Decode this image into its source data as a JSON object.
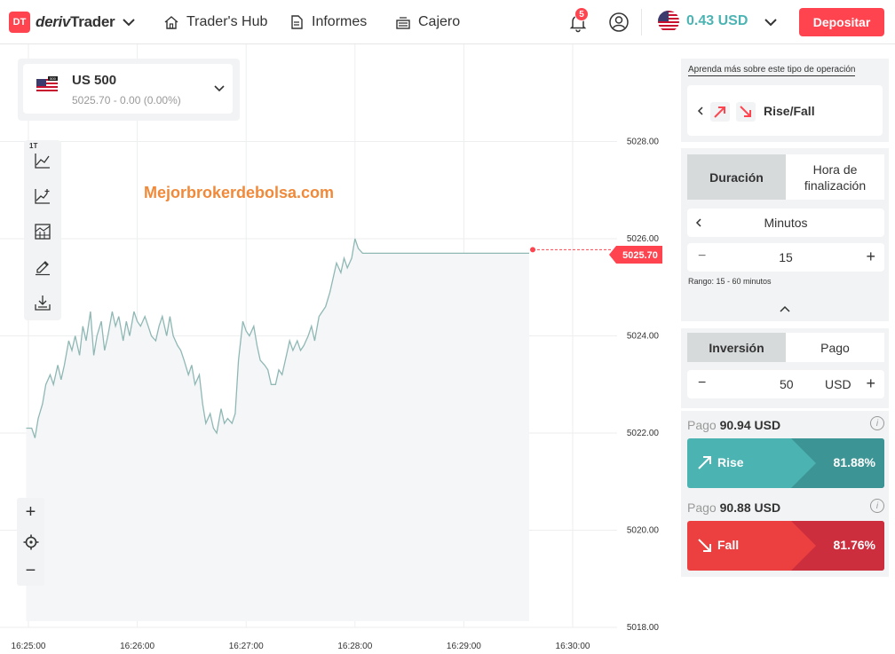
{
  "header": {
    "logo_badge": "DT",
    "logo_brand": "deriv",
    "logo_product": "Trader",
    "nav": [
      {
        "label": "Trader's Hub",
        "icon": "home-icon"
      },
      {
        "label": "Informes",
        "icon": "reports-icon"
      },
      {
        "label": "Cajero",
        "icon": "cashier-icon"
      }
    ],
    "notifications_count": "5",
    "balance": "0.43 USD",
    "deposit_label": "Depositar"
  },
  "chart": {
    "symbol_name": "US 500",
    "symbol_quote": "5025.70 - 0.00 (0.00%)",
    "flag_label": "500",
    "current_price": "5025.70",
    "watermark": "Mejorbrokerdebolsa.com",
    "toolbar_interval": "1T",
    "zoom_in": "+",
    "zoom_out": "−"
  },
  "chart_data": {
    "type": "area",
    "y_ticks": [
      "5018.00",
      "5020.00",
      "5022.00",
      "5024.00",
      "5026.00",
      "5028.00"
    ],
    "x_ticks": [
      "16:25:00",
      "16:26:00",
      "16:27:00",
      "16:28:00",
      "16:29:00",
      "16:30:00"
    ],
    "ylim": [
      5018,
      5030
    ],
    "x": [
      -0.02,
      0.03,
      0.06,
      0.09,
      0.13,
      0.16,
      0.2,
      0.23,
      0.27,
      0.3,
      0.33,
      0.37,
      0.4,
      0.43,
      0.47,
      0.5,
      0.53,
      0.57,
      0.6,
      0.63,
      0.67,
      0.7,
      0.73,
      0.77,
      0.8,
      0.83,
      0.87,
      0.9,
      0.93,
      0.97,
      1.0,
      1.03,
      1.07,
      1.1,
      1.13,
      1.17,
      1.2,
      1.23,
      1.27,
      1.3,
      1.33,
      1.37,
      1.4,
      1.43,
      1.47,
      1.5,
      1.53,
      1.57,
      1.6,
      1.63,
      1.67,
      1.7,
      1.73,
      1.77,
      1.8,
      1.83,
      1.87,
      1.9,
      1.93,
      1.97,
      2.0,
      2.03,
      2.07,
      2.1,
      2.13,
      2.17,
      2.2,
      2.23,
      2.27,
      2.3,
      2.33,
      2.37,
      2.4,
      2.43,
      2.47,
      2.5,
      2.53,
      2.57,
      2.6,
      2.63,
      2.67,
      2.7,
      2.73,
      2.77,
      2.8,
      2.83,
      2.87,
      2.9,
      2.93,
      2.97,
      3.0,
      3.03,
      3.07,
      3.1,
      3.13,
      3.17,
      3.2,
      3.23,
      3.27,
      3.3,
      3.33,
      3.37,
      3.4,
      3.43,
      3.47,
      3.5,
      3.53,
      3.57,
      3.6,
      3.63,
      3.67,
      3.7,
      3.73,
      3.77,
      3.8,
      3.83,
      3.87,
      3.9,
      3.93,
      3.97,
      4.0,
      4.03,
      4.07,
      4.1,
      4.13,
      4.17,
      4.2,
      4.23,
      4.27,
      4.3,
      4.33,
      4.37,
      4.4,
      4.43,
      4.47,
      4.5,
      4.53,
      4.57,
      4.6,
      4.63,
      4.67,
      4.7,
      4.73,
      4.77,
      4.8,
      4.83,
      4.87,
      4.9
    ],
    "y": [
      5022.1,
      5022.1,
      5021.9,
      5022.3,
      5022.6,
      5023.0,
      5023.2,
      5023.0,
      5023.4,
      5023.1,
      5023.4,
      5023.9,
      5023.7,
      5024.0,
      5023.6,
      5024.2,
      5023.9,
      5024.5,
      5023.6,
      5024.0,
      5024.3,
      5023.7,
      5024.0,
      5024.5,
      5024.2,
      5024.4,
      5023.9,
      5024.3,
      5024.0,
      5024.5,
      5024.3,
      5024.2,
      5024.4,
      5024.2,
      5024.0,
      5023.9,
      5024.2,
      5024.4,
      5024.0,
      5024.4,
      5024.0,
      5023.8,
      5023.7,
      5023.5,
      5023.2,
      5023.4,
      5023.0,
      5023.2,
      5022.6,
      5022.2,
      5022.4,
      5022.1,
      5022.0,
      5022.5,
      5022.2,
      5022.3,
      5022.2,
      5022.4,
      5023.5,
      5024.3,
      5024.1,
      5024.0,
      5024.2,
      5023.8,
      5023.5,
      5023.4,
      5023.3,
      5023.0,
      5023.0,
      5023.3,
      5023.2,
      5023.6,
      5023.9,
      5023.7,
      5023.9,
      5023.7,
      5023.8,
      5024.0,
      5024.2,
      5023.9,
      5024.4,
      5024.5,
      5024.6,
      5024.9,
      5025.2,
      5025.5,
      5025.3,
      5025.6,
      5025.4,
      5025.6,
      5026.0,
      5025.8,
      5025.7,
      5025.7,
      5025.7,
      5025.7,
      5025.7,
      5025.7,
      5025.7,
      5025.7,
      5025.7,
      5025.7,
      5025.7,
      5025.7,
      5025.7,
      5025.7,
      5025.7,
      5025.7,
      5025.7,
      5025.7,
      5025.7,
      5025.7,
      5025.7,
      5025.7,
      5025.7,
      5025.7,
      5025.7,
      5025.7,
      5025.7,
      5025.7,
      5025.7,
      5025.7,
      5025.7,
      5025.7,
      5025.7,
      5025.7,
      5025.7,
      5025.7,
      5025.7,
      5025.7,
      5025.7,
      5025.7,
      5025.7,
      5025.7,
      5025.7,
      5025.7,
      5025.7,
      5025.7,
      5025.7,
      5025.7,
      5025.7,
      5025.7,
      5025.7,
      5025.7
    ],
    "colors": {
      "line": "#8fb8b5",
      "fill": "#f4f6f7",
      "price": "#ff444f"
    }
  },
  "sidebar": {
    "learn_more": "Aprenda más sobre este tipo de operación",
    "trade_type": "Rise/Fall",
    "duration_tab": "Duración",
    "end_time_tab_line1": "Hora de",
    "end_time_tab_line2": "finalización",
    "duration_unit": "Minutos",
    "duration_value": "15",
    "range_text": "Rango: 15 - 60 minutos",
    "stake_tab": "Inversión",
    "payout_tab": "Pago",
    "stake_value": "50",
    "stake_currency": "USD",
    "rise": {
      "payout_label": "Pago",
      "payout_value": "90.94 USD",
      "label": "Rise",
      "percent": "81.88%"
    },
    "fall": {
      "payout_label": "Pago",
      "payout_value": "90.88 USD",
      "label": "Fall",
      "percent": "81.76%"
    }
  }
}
